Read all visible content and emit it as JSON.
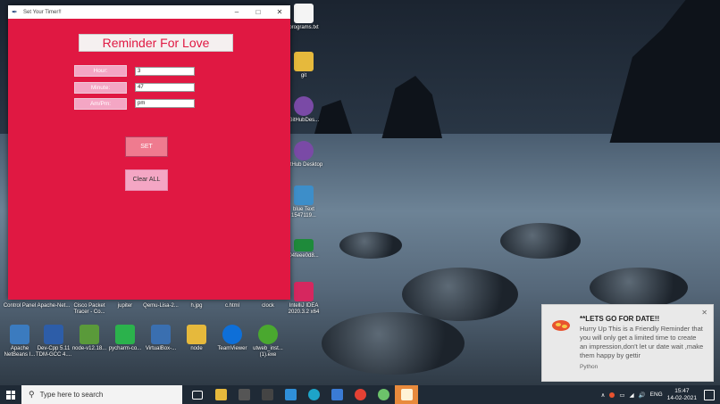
{
  "window": {
    "title": "Set Your Timer!!",
    "heading": "Reminder For Love",
    "fields": [
      {
        "label": "Hour:",
        "value": "3"
      },
      {
        "label": "Minute:",
        "value": "47"
      },
      {
        "label": "Am/Pm:",
        "value": "pm"
      }
    ],
    "set_label": "SET",
    "clear_label": "Clear ALL"
  },
  "desktop_icons": [
    {
      "label": "programs.txt",
      "color": "#f4f4f4"
    },
    {
      "label": "git",
      "color": "#e6b93c"
    },
    {
      "label": "GitHubDes...",
      "color": "#7a4aa6"
    },
    {
      "label": "GitHub Desktop",
      "color": "#7a4aa6"
    },
    {
      "label": "blue Text 1547119...",
      "color": "#3d8ec9"
    },
    {
      "label": "04feee0d8...",
      "color": "#1e8a3a"
    },
    {
      "label": "IntelliJ IDEA 2020.3.2 x64",
      "color": "#d6275f"
    },
    {
      "label": "Apache NetBeans I...",
      "color": "#3b7bbf"
    },
    {
      "label": "Dev-Cpp 5.11 TDM-GCC 4....",
      "color": "#2d5da8"
    },
    {
      "label": "node-v12.18...",
      "color": "#5a9a3a"
    },
    {
      "label": "pycharm-co...",
      "color": "#2bb24c"
    },
    {
      "label": "VirtualBox-...",
      "color": "#3a6fb0"
    },
    {
      "label": "node",
      "color": "#e6b93c"
    },
    {
      "label": "TeamViewer",
      "color": "#0e6fd8"
    },
    {
      "label": "utweb_inst... (1).exe",
      "color": "#4aa82f"
    }
  ],
  "desktop_row_labels": [
    "Control Panel",
    "Apache-Net...",
    "Cisco Packet Tracer - Co...",
    "jupiter",
    "Qemu-Lisa-2...",
    "h.jpg",
    "c.html",
    "clock"
  ],
  "notification": {
    "title": "**LETS GO FOR DATE!!",
    "body": "Hurry Up This is a Friendly Reminder that you will only get a limited time to create an impression,don't let ur date wait ,make them happy by gettir",
    "app": "Python"
  },
  "taskbar": {
    "search_placeholder": "Type here to search",
    "lang": "ENG",
    "time": "15:47",
    "date": "14-02-2021"
  }
}
